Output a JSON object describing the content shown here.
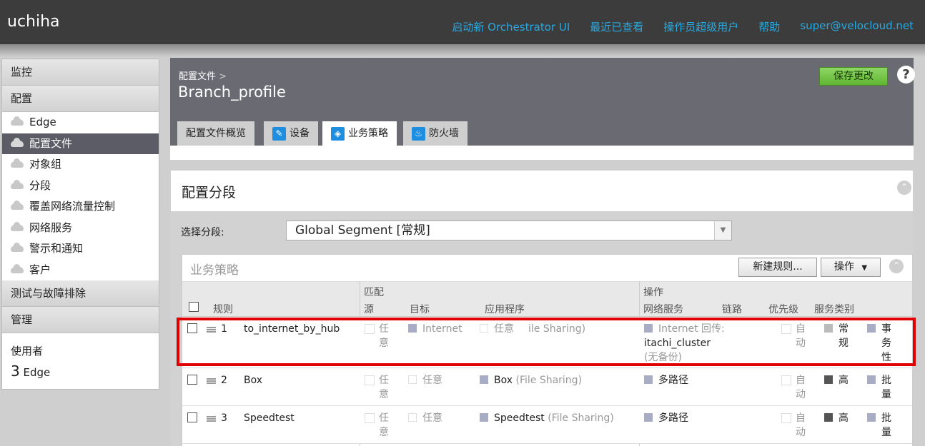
{
  "app": {
    "brand": "uchiha"
  },
  "topnav": {
    "launch": "启动新 Orchestrator UI",
    "recent": "最近已查看",
    "operator": "操作员超级用户",
    "help": "帮助",
    "user": "super@velocloud.net"
  },
  "sidebar": {
    "monitor": "监控",
    "configure": "配置",
    "items": [
      {
        "label": "Edge"
      },
      {
        "label": "配置文件"
      },
      {
        "label": "对象组"
      },
      {
        "label": "分段"
      },
      {
        "label": "覆盖网络流量控制"
      },
      {
        "label": "网络服务"
      },
      {
        "label": "警示和通知"
      },
      {
        "label": "客户"
      }
    ],
    "test": "测试与故障排除",
    "admin": "管理",
    "usage_label": "使用者",
    "usage_count": "3",
    "usage_unit": "Edge"
  },
  "header": {
    "breadcrumb": "配置文件",
    "breadcrumb_sep": ">",
    "title": "Branch_profile",
    "save": "保存更改",
    "help": "?"
  },
  "tabs": [
    {
      "label": "配置文件概览"
    },
    {
      "label": "设备"
    },
    {
      "label": "业务策略"
    },
    {
      "label": "防火墙"
    }
  ],
  "section": {
    "title": "配置分段",
    "segment_label": "选择分段:",
    "segment_value": "Global Segment [常规]"
  },
  "business_policy": {
    "title": "业务策略",
    "new_rule": "新建规则...",
    "actions": "操作",
    "group_match": "匹配",
    "group_action": "操作",
    "col_rule": "规则",
    "col_source": "源",
    "col_dest": "目标",
    "col_app": "应用程序",
    "col_netsvc": "网络服务",
    "col_link": "链路",
    "col_priority": "优先级",
    "col_svcclass": "服务类别",
    "rows": [
      {
        "num": "1",
        "name": "to_internet_by_hub",
        "source_1": "任",
        "source_2": "意",
        "dest": "Internet",
        "app_any": "任意",
        "app": "ile Sharing)",
        "netsvc_1": "Internet 回传:",
        "netsvc_2": "itachi_cluster",
        "netsvc_3": "(无备份)",
        "link_1": "自",
        "link_2": "动",
        "priority_1": "常",
        "priority_2": "规",
        "svc_1": "事",
        "svc_2": "务",
        "svc_3": "性"
      },
      {
        "num": "2",
        "name": "Box",
        "source_1": "任",
        "source_2": "意",
        "dest": "任意",
        "app_name": "Box",
        "app_cat": "(File Sharing)",
        "netsvc_1": "多路径",
        "link_1": "自",
        "link_2": "动",
        "priority_1": "高",
        "svc_1": "批",
        "svc_2": "量"
      },
      {
        "num": "3",
        "name": "Speedtest",
        "source_1": "任",
        "source_2": "意",
        "dest": "任意",
        "app_name": "Speedtest",
        "app_cat": "(File Sharing)",
        "netsvc_1": "多路径",
        "link_1": "自",
        "link_2": "动",
        "priority_1": "高",
        "svc_1": "批",
        "svc_2": "量"
      }
    ]
  }
}
